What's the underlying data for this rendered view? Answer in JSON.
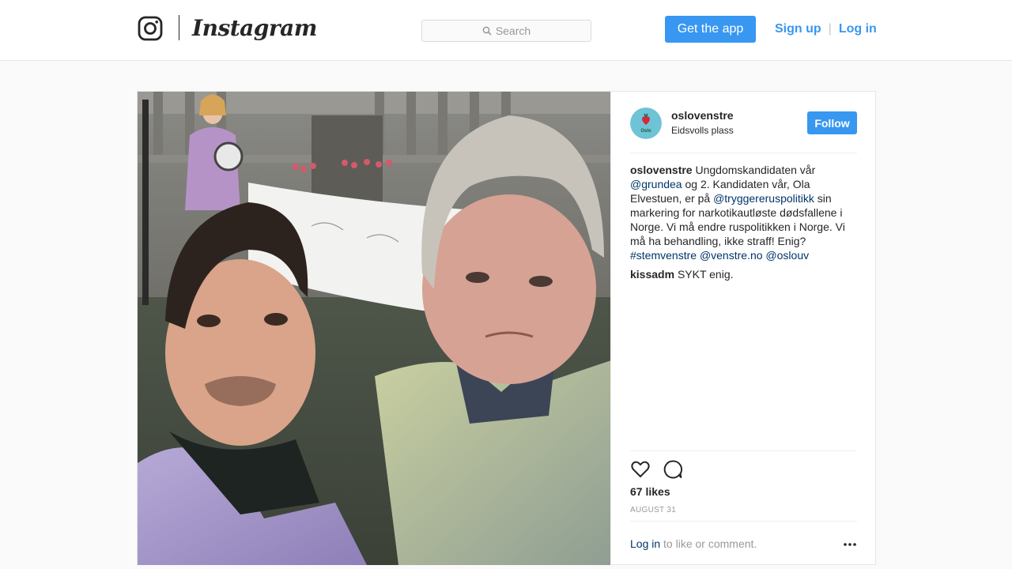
{
  "header": {
    "brand": "Instagram",
    "logo_icon": "instagram-camera-icon",
    "search_placeholder": "Search",
    "search_icon": "search-icon",
    "get_app_label": "Get the app",
    "signup_label": "Sign up",
    "separator": "|",
    "login_label": "Log in"
  },
  "post": {
    "photo_icon": "selfie-photo",
    "author": {
      "username": "oslovenstre",
      "location": "Eidsvolls plass",
      "follow_label": "Follow",
      "avatar_text": "Oslo"
    },
    "caption": {
      "username": "oslovenstre",
      "text_1": "Ungdomskandidaten vår",
      "mention_1": "@grundea",
      "text_2": "og 2. Kandidaten vår, Ola Elvestuen, er på",
      "mention_2": "@tryggereruspolitikk",
      "text_3": "sin markering for narkotikautløste dødsfallene i Norge. Vi må endre ruspolitikken i Norge. Vi må ha behandling, ikke straff! Enig?",
      "hashtag": "#stemvenstre",
      "mention_3": "@venstre.no",
      "mention_4": "@oslouv"
    },
    "comments": [
      {
        "username": "kissadm",
        "text": "SYKT enig."
      }
    ],
    "likes": "67 likes",
    "date": "AUGUST 31",
    "login_prompt": {
      "link": "Log in",
      "text": "to like or comment."
    }
  },
  "colors": {
    "accent": "#3897f0",
    "link": "#003569",
    "muted": "#999999",
    "border": "#efefef"
  }
}
